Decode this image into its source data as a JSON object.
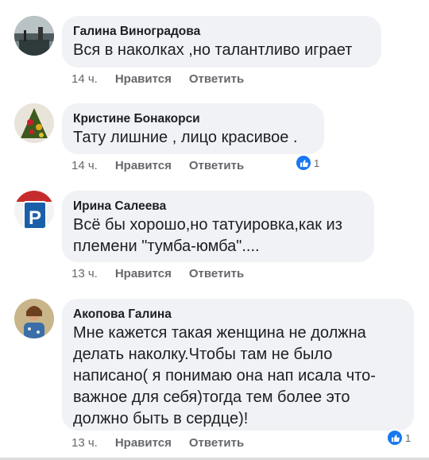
{
  "comments": [
    {
      "author": "Галина Виноградова",
      "lines": [
        "Вся в наколках ,но талантливо играет"
      ],
      "time": "14 ч.",
      "like_label": "Нравится",
      "reply_label": "Ответить",
      "reactions": ""
    },
    {
      "author": "Кристине Бонакорси",
      "lines": [
        "Тату лишние , лицо красивое ."
      ],
      "time": "14 ч.",
      "like_label": "Нравится",
      "reply_label": "Ответить",
      "reactions": "1"
    },
    {
      "author": "Ирина Салеева",
      "lines": [
        "Всё бы хорошо,но татуировка,как из",
        "племени \"тумба-юмба\"...."
      ],
      "time": "13 ч.",
      "like_label": "Нравится",
      "reply_label": "Ответить",
      "reactions": ""
    },
    {
      "author": "Акопова Галина",
      "lines": [
        "Мне кажется такая женщина не должна",
        "делать наколку.Чтобы там не было",
        "написано( я понимаю она нап исала что-",
        "важное для себя)тогда тем более это",
        "должно быть в сердце)!"
      ],
      "time": "13 ч.",
      "like_label": "Нравится",
      "reply_label": "Ответить",
      "reactions": "1"
    }
  ],
  "avatar3_sign_text": "P",
  "colors": {
    "bubble": "#f0f2f5",
    "meta": "#65676b",
    "like": "#1877f2"
  }
}
